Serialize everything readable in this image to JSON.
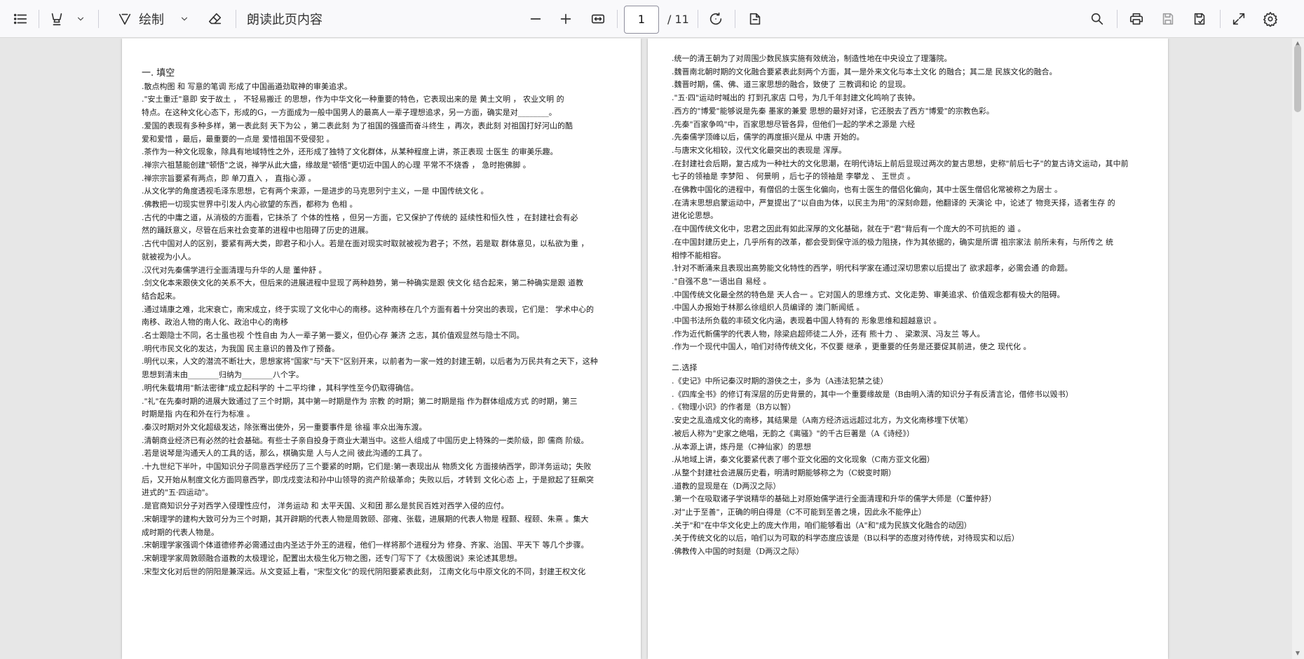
{
  "toolbar": {
    "draw_label": "绘制",
    "read_aloud_label": "朗读此页内容",
    "page_number": "1",
    "page_total": "/ 11"
  },
  "page1": [
    {
      "t": "一. 填空",
      "h": true
    },
    {
      "t": ".散点构图 和 写意的笔调 形成了中国画遒劲取神的审美追求。"
    },
    {
      "t": ".\"安土重迁\"意即 安于故土 ， 不轻易搬迁 的思想，作为中华文化一种重要的特色，它表现出来的是 黄土文明 ， 农业文明 的"
    },
    {
      "t": "特点。在这种文化心态下，形成的G，一方面成为一般中国男人的最高人一辈子理想追求，另一方面，确实是对________。"
    },
    {
      "t": ".爱国的表现有多种多样，第一表此刻 天下为公 ，第二表此刻 为了祖国的强盛而奋斗终生 ，再次，表此刻 对祖国打好河山的酷"
    },
    {
      "t": "爱和爱惜 ，最后，最重要的一点是 爱惜祖国不受侵犯 。"
    },
    {
      "t": ".茶作为一种文化现象，除具有地域特性之外，还形成了独特了文化群体，从某种程度上讲，茶正表现 士医生 的审美乐趣。"
    },
    {
      "t": ".禅宗六祖慧能创建\"顿悟\"之说，禅学从此大盛，缘故是\"顿悟\"更切近中国人的心理 平常不不烧香 ， 急时抱佛脚 。"
    },
    {
      "t": ".禅宗宗旨要紧有两点，即 单刀直入 ， 直指心源 。"
    },
    {
      "t": ".从文化学的角度透视毛泽东思想，它有两个来源，一是进步的马克思列宁主义，一是 中国传统文化 。"
    },
    {
      "t": ".佛教把一切现实世界中引发人内心欲望的东西，都称为 色相 。"
    },
    {
      "t": ".古代的中庸之道，从消极的方面看，它抹杀了 个体的性格 ，但另一方面，它又保护了传统的 延续性和恒久性 ，在封建社会有必"
    },
    {
      "t": "然的踊跃意义，尽管在后来社会变革的进程中也阻碍了历史的进展。"
    },
    {
      "t": ".古代中国对人的区别，要紧有两大类，即君子和小人。若是在面对现实时取就被视为君子；不然，若是取 群体意见，以私欲为重 ，"
    },
    {
      "t": "就被视为小人。"
    },
    {
      "t": ".汉代对先秦儒学进行全面清理与升华的人是 董仲舒 。"
    },
    {
      "t": ".剑文化本来跟侠文化的关系不大，但后来的进展进程中显现了两种趋势，第一种确实是跟 侠文化 结合起来，第二种确实是跟 道教"
    },
    {
      "t": "结合起来。"
    },
    {
      "t": ".通过靖康之难，北宋衰亡，南宋成立，终于实现了文化中心的南移。这种南移在几个方面有着十分突出的表现，它们是： 学术中心的"
    },
    {
      "t": "南移、政治人物的南人化、政治中心的南移"
    },
    {
      "t": ".名士跟隐士不同，名士虽也视 个性自由 为人一辈子第一要义，但仍心存 兼济 之志，其价值观显然与隐士不同。"
    },
    {
      "t": ".明代市民文化的发达，为我国 民主意识的普及作了预备。"
    },
    {
      "t": ".明代以来，人文的潜流不断壮大，思想家将\"国家\"与\"天下\"区别开来，以前者为一家一姓的封建王朝，以后者为万民共有之天下，这种"
    },
    {
      "t": "思想到清末由________归纳为________八个字。"
    },
    {
      "t": ".明代朱载堉用\"新法密律\"成立起科学的 十二平均律 ，其科学性至今仍取得确信。"
    },
    {
      "t": ".\"礼\"在先秦时期的进展大致通过了三个时期，其中第一时期是作为 宗教 的时期；第二时期是指 作为群体组成方式 的时期，第三"
    },
    {
      "t": "时期是指 内在和外在行为标准 。"
    },
    {
      "t": ".秦汉时期对外文化超级发达，除张骞出使外，另一重要事件是 徐福 率众出海东渡。"
    },
    {
      "t": ".清朝商业经济已有必然的社会基础。有些士子亲自投身于商业大潮当中。这些人组成了中国历史上特殊的一类阶级，即 儒商 阶级。"
    },
    {
      "t": ".若是说琴是沟通天人的工具的话，那么，棋确实是 人与人之间 彼此沟通的工具了。"
    },
    {
      "t": ".十九世纪下半叶，中国知识分子同意西学经历了三个要紧的时期，它们是:第一表现出从 物质文化 方面接纳西学，即洋务运动；失败"
    },
    {
      "t": "后，又开始从制度文化方面同意西学，即戊戌变法和孙中山领导的资产阶级革命；失败以后，才转到 文化心态 上，于是掀起了狂飙突"
    },
    {
      "t": "进式的\"五·四运动\"。"
    },
    {
      "t": ".是官商知识分子对西学入侵理性应付， 洋务运动 和 太平天国、义和团 那么是贫民百姓对西学入侵的应付。"
    },
    {
      "t": ".宋朝理学的建构大致可分为三个时期，其开辟期的代表人物是周敦颐、邵雍、张载，进展期的代表人物是 程颢、程颐、朱熹 。集大"
    },
    {
      "t": "成时期的代表人物是。"
    },
    {
      "t": ".宋朝理学家强调个体道德修养必需通过由内圣达于外王的进程，他们一样将那个进程分为 修身、齐家、治国、平天下 等几个步骤。"
    },
    {
      "t": ".宋朝理学家周敦颐融合道教的太极理论，配置出太极生化万物之图，还专门写下了《太极图说》来论述其思想。"
    },
    {
      "t": ".宋型文化对后世的阴阳是兼深远。从文变延上看，\"宋型文化\"的现代阴阳要紧表此刻， 江南文化与中原文化的不同，封建王权文化"
    }
  ],
  "page2": [
    {
      "t": ".统一的清王朝为了对周围少数民族实施有效统治，制造性地在中央设立了理藩院。"
    },
    {
      "t": ".魏晋南北朝时期的文化融合要紧表此刻两个方面，其一是外来文化与本土文化 的融合；其二是 民族文化的融合。"
    },
    {
      "t": ".魏晋时期，儒、佛、道三家思想的融合，致使了 三教调和论 的显现。"
    },
    {
      "t": ".\"五·四\"运动时喊出的 打到孔家店 口号，为几千年封建文化鸣响了丧钟。"
    },
    {
      "t": ".西方的\"博爱\"能够说是先秦 墨家的兼爱 思想的最好对译，它还脱去了西方\"博爱\"的宗教色彩。"
    },
    {
      "t": ".先秦\"百家争鸣\"中，百家思想尽管各异，但他们一起的学术之源是 六经"
    },
    {
      "t": ".先秦儒学顶峰以后，儒学的再度振兴是从 中唐 开始的。"
    },
    {
      "t": ".与唐宋文化相较，汉代文化最突出的表现是 浑厚。"
    },
    {
      "t": ".在封建社会后期，复古成为一种社大的文化思潮，在明代诗坛上前后显现过两次的复古思想，史称\"前后七子\"的复古诗文运动，其中前"
    },
    {
      "t": "七子的领袖是 李梦阳 、 何景明 ，后七子的领袖是 李攀龙 、 王世贞 。"
    },
    {
      "t": ".在佛教中国化的进程中，有僧侣的士医生化偏向，也有士医生的僧侣化偏向，其中士医生僧侣化常被称之为居士 。"
    },
    {
      "t": ".在清末思想启蒙运动中，严复提出了\"以自由为体，以民主为用\"的深刻命题，他翻译的 天演论 中，论述了 物竞天择，适者生存 的"
    },
    {
      "t": "进化论思想。"
    },
    {
      "t": ".在中国传统文化中，忠君之因此有如此深厚的文化基础，就在于\"君\"背后有一个庞大的不可抗拒的 道 。"
    },
    {
      "t": ".在中国封建历史上，几乎所有的改革，都会受到保守派的极力阻挠，作为其依据的，确实是所谓 祖宗家法 前所未有，与所传之 统"
    },
    {
      "t": "相悖不能相容。"
    },
    {
      "t": ".针对不断涌来且表现出高势能文化特性的西学，明代科学家在通过深切思索以后提出了 欲求超孝，必需会通 的命题。"
    },
    {
      "t": ".\"自强不息\"一语出自 易经 。"
    },
    {
      "t": ".中国传统文化最全然的特色是 天人合一 。它对国人的思维方式、文化走势、审美追求、价值观念都有极大的阻碍。"
    },
    {
      "t": ".中国人办报始于林那么徐组织人员编译的 澳门新闻纸 。"
    },
    {
      "t": ".中国书法所负载的丰硕文化内涵，表现着中国人特有的 形象思维和超越意识 。"
    },
    {
      "t": ".作为近代新儒学的代表人物，除梁启超师徒二人外，还有 熊十力 、 梁漱溟、冯友兰 等人。"
    },
    {
      "t": ".作为一个现代中国人，咱们对待传统文化，不仅要 继承 ，更重要的任务是还要促其前进，使之 现代化 。"
    },
    {
      "t": "",
      "gap": true
    },
    {
      "t": "二.选择"
    },
    {
      "t": ".《史记》中所记秦汉时期的游侠之士，多为（A违法犯禁之徒）"
    },
    {
      "t": ".《四库全书》的修订有深层的历史背景的，其中一个重要缘故是（B由明入清的知识分子有反清言论，借修书以毁书）"
    },
    {
      "t": ".《物理小识》的作者是（B方以智）"
    },
    {
      "t": ".安史之乱造成文化的南移，其结果是（A南方经济远远超过北方，为文化南移埋下伏笔）"
    },
    {
      "t": ".被后人称为\"史家之绝唱，无韵之《离骚》\"的千古巨著是（A《诗经》）"
    },
    {
      "t": ".从本源上讲，炼丹是（C神仙家）的思想"
    },
    {
      "t": ".从地域上讲，秦文化要紧代表了哪个亚文化圈的文化现象（C南方亚文化圈）"
    },
    {
      "t": ".从整个封建社会进展历史看，明清时期能够称之为（C蜕变时期）"
    },
    {
      "t": ".道教的显现是在（D两汉之际）"
    },
    {
      "t": ".第一个在吸取诸子学说精华的基础上对原始儒学进行全面清理和升华的儒学大师是（C董仲舒）"
    },
    {
      "t": ".对\"止于至善\"，正确的明白得是（C不可能到至善之境，因此永不能停止）"
    },
    {
      "t": ".关于\"和\"在中华文化史上的庞大作用，咱们能够看出（A\"和\"成为民族文化融合的动因）"
    },
    {
      "t": ".关于传统文化的以后，咱们以为可取的科学态度应该是（B以科学的态度对待传统，对待现实和以后）"
    },
    {
      "t": ".佛教传入中国的时刻是（D两汉之际）"
    }
  ]
}
